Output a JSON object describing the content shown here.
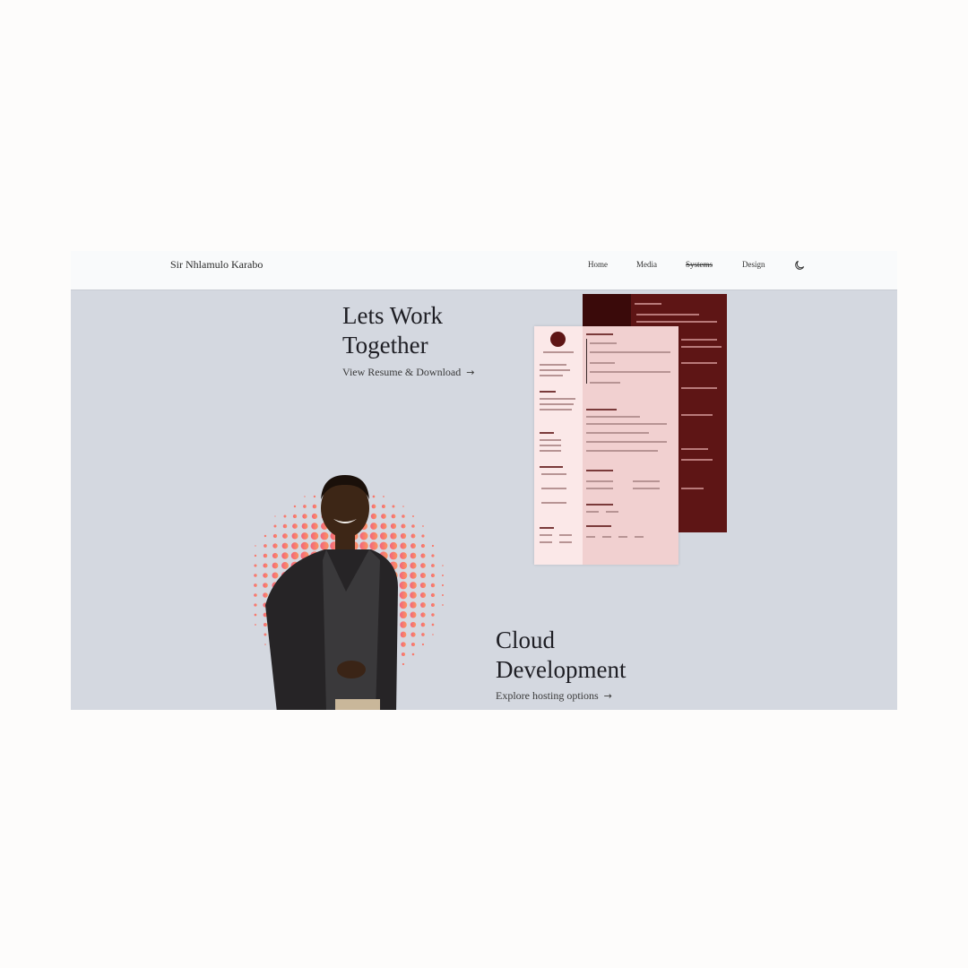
{
  "nav": {
    "brand": "Sir Nhlamulo Karabo",
    "links": [
      {
        "label": "Home"
      },
      {
        "label": "Media"
      },
      {
        "label": "Systems"
      },
      {
        "label": "Design"
      }
    ],
    "theme_toggle_icon": "moon-icon"
  },
  "hero1": {
    "heading_line1": "Lets Work",
    "heading_line2": "Together",
    "cta": "View Resume & Download",
    "cta_icon": "arrow-right-icon"
  },
  "hero2": {
    "heading_line1": "Cloud",
    "heading_line2": "Development",
    "cta": "Explore hosting options",
    "cta_icon": "arrow-right-icon"
  },
  "colors": {
    "frame_bg": "#d4d8e0",
    "resume_dark": "#5e1515",
    "resume_light": "#f1d0d0",
    "halftone_start": "#f2627e",
    "halftone_end": "#fb9560"
  }
}
